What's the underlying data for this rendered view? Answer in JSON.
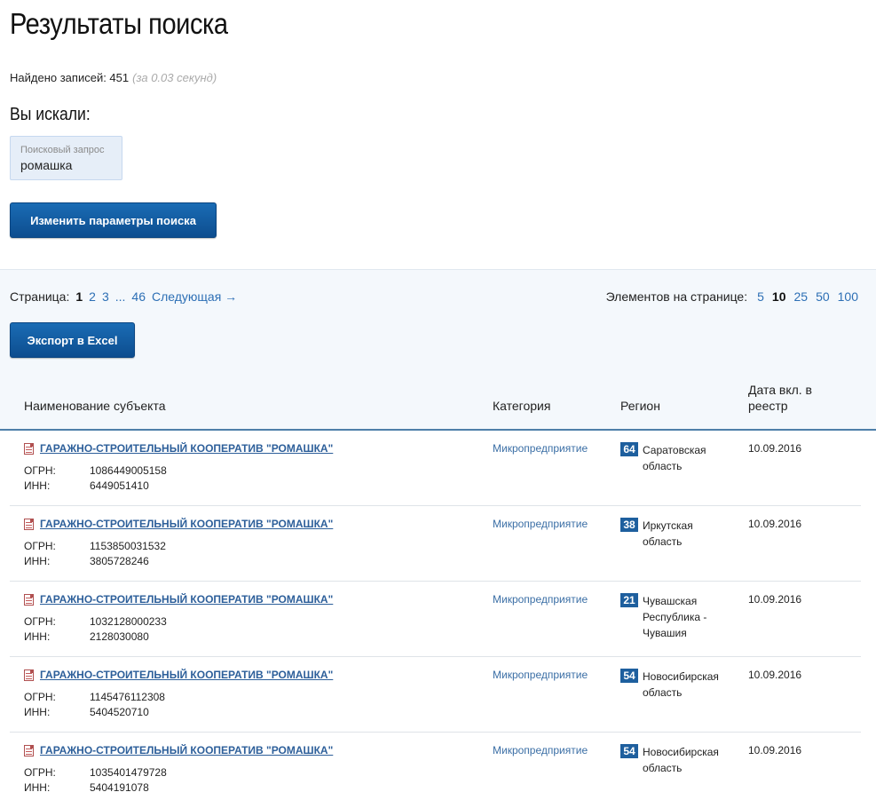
{
  "header": {
    "title": "Результаты поиска",
    "found_label": "Найдено записей: 451",
    "found_time": "(за 0.03 секунд)",
    "searched_title": "Вы искали:"
  },
  "query": {
    "label": "Поисковый запрос",
    "value": "ромашка"
  },
  "buttons": {
    "change_search": "Изменить параметры поиска",
    "export": "Экспорт в Excel"
  },
  "pagination": {
    "label": "Страница:",
    "pages": [
      "1",
      "2",
      "3",
      "...",
      "46"
    ],
    "current": "1",
    "next": "Следующая →"
  },
  "per_page": {
    "label": "Элементов на странице:",
    "options": [
      "5",
      "10",
      "25",
      "50",
      "100"
    ],
    "current": "10"
  },
  "table": {
    "headers": {
      "name": "Наименование субъекта",
      "category": "Категория",
      "region": "Регион",
      "date": "Дата вкл. в реестр"
    },
    "field_labels": {
      "ogrn": "ОГРН:",
      "inn": "ИНН:"
    },
    "rows": [
      {
        "name": "ГАРАЖНО-СТРОИТЕЛЬНЫЙ КООПЕРАТИВ \"РОМАШКА\"",
        "ogrn": "1086449005158",
        "inn": "6449051410",
        "category": "Микропредприятие",
        "region_code": "64",
        "region": "Саратовская область",
        "date": "10.09.2016"
      },
      {
        "name": "ГАРАЖНО-СТРОИТЕЛЬНЫЙ КООПЕРАТИВ \"РОМАШКА\"",
        "ogrn": "1153850031532",
        "inn": "3805728246",
        "category": "Микропредприятие",
        "region_code": "38",
        "region": "Иркутская область",
        "date": "10.09.2016"
      },
      {
        "name": "ГАРАЖНО-СТРОИТЕЛЬНЫЙ КООПЕРАТИВ \"РОМАШКА\"",
        "ogrn": "1032128000233",
        "inn": "2128030080",
        "category": "Микропредприятие",
        "region_code": "21",
        "region": "Чувашская Республика - Чувашия",
        "date": "10.09.2016"
      },
      {
        "name": "ГАРАЖНО-СТРОИТЕЛЬНЫЙ КООПЕРАТИВ \"РОМАШКА\"",
        "ogrn": "1145476112308",
        "inn": "5404520710",
        "category": "Микропредприятие",
        "region_code": "54",
        "region": "Новосибирская область",
        "date": "10.09.2016"
      },
      {
        "name": "ГАРАЖНО-СТРОИТЕЛЬНЫЙ КООПЕРАТИВ \"РОМАШКА\"",
        "ogrn": "1035401479728",
        "inn": "5404191078",
        "category": "Микропредприятие",
        "region_code": "54",
        "region": "Новосибирская область",
        "date": "10.09.2016"
      }
    ]
  }
}
